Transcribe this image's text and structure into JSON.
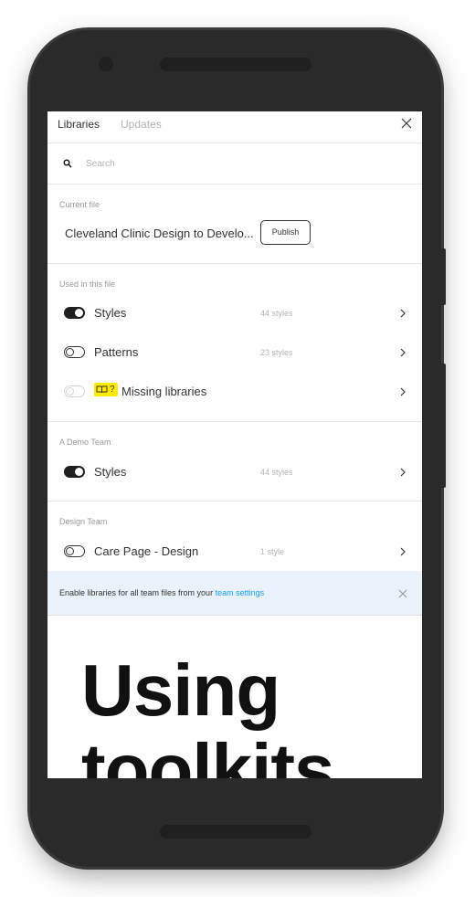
{
  "tabs": {
    "active": "Libraries",
    "inactive": "Updates"
  },
  "search": {
    "placeholder": "Search"
  },
  "current_file": {
    "label": "Current file",
    "name": "Cleveland Clinic Design to Develo...",
    "publish_label": "Publish"
  },
  "used_in_file": {
    "label": "Used in this file",
    "items": [
      {
        "name": "Styles",
        "count": "44 styles",
        "toggle": "on"
      },
      {
        "name": "Patterns",
        "count": "23 styles",
        "toggle": "off"
      },
      {
        "name": "Missing libraries",
        "badge": "?",
        "toggle": "disabled"
      }
    ]
  },
  "demo_team": {
    "label": "A Demo Team",
    "items": [
      {
        "name": "Styles",
        "count": "44 styles",
        "toggle": "on"
      }
    ]
  },
  "design_team": {
    "label": "Design Team",
    "items": [
      {
        "name": "Care Page - Design",
        "count": "1 style",
        "toggle": "off"
      }
    ]
  },
  "banner": {
    "text": "Enable libraries for all team files from your ",
    "link": "team settings",
    "background": "#eaf2fb",
    "link_color": "#18a0fb"
  },
  "hero": {
    "line1": "Using",
    "line2": "toolkits"
  },
  "colors": {
    "badge": "#ffeb00",
    "phone_body": "#2a2a2a"
  },
  "icons": [
    "close-icon",
    "search-icon",
    "chevron-right-icon",
    "library-book-icon"
  ]
}
